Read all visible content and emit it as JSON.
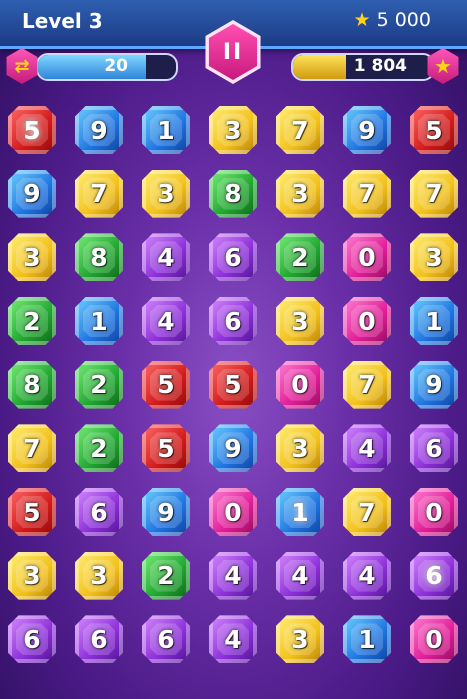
{
  "header": {
    "level_label": "Level 3",
    "score": "5 000",
    "pause_label": "II",
    "moves_value": "20",
    "moves_fill_fraction": 0.78,
    "target_value": "1 804",
    "target_fill_fraction": 0.38,
    "moves_icon": "swap-arrows-icon",
    "target_icon": "star-icon"
  },
  "colors": {
    "red": "#d11919",
    "blue": "#1e73e0",
    "yellow": "#f2c01a",
    "green": "#1fa52f",
    "purple": "#8b2ed8",
    "pink": "#e01c96"
  },
  "board": [
    [
      {
        "n": "5",
        "c": "red",
        "s": true
      },
      {
        "n": "9",
        "c": "blue"
      },
      {
        "n": "1",
        "c": "blue"
      },
      {
        "n": "3",
        "c": "yellow"
      },
      {
        "n": "7",
        "c": "yellow"
      },
      {
        "n": "9",
        "c": "blue"
      },
      {
        "n": "5",
        "c": "red"
      }
    ],
    [
      {
        "n": "9",
        "c": "blue"
      },
      {
        "n": "7",
        "c": "yellow"
      },
      {
        "n": "3",
        "c": "yellow"
      },
      {
        "n": "8",
        "c": "green"
      },
      {
        "n": "3",
        "c": "yellow"
      },
      {
        "n": "7",
        "c": "yellow"
      },
      {
        "n": "7",
        "c": "yellow"
      }
    ],
    [
      {
        "n": "3",
        "c": "yellow"
      },
      {
        "n": "8",
        "c": "green"
      },
      {
        "n": "4",
        "c": "purple"
      },
      {
        "n": "6",
        "c": "purple"
      },
      {
        "n": "2",
        "c": "green"
      },
      {
        "n": "0",
        "c": "pink"
      },
      {
        "n": "3",
        "c": "yellow"
      }
    ],
    [
      {
        "n": "2",
        "c": "green"
      },
      {
        "n": "1",
        "c": "blue"
      },
      {
        "n": "4",
        "c": "purple"
      },
      {
        "n": "6",
        "c": "purple"
      },
      {
        "n": "3",
        "c": "yellow"
      },
      {
        "n": "0",
        "c": "pink"
      },
      {
        "n": "1",
        "c": "blue"
      }
    ],
    [
      {
        "n": "8",
        "c": "green"
      },
      {
        "n": "2",
        "c": "green"
      },
      {
        "n": "5",
        "c": "red"
      },
      {
        "n": "5",
        "c": "red"
      },
      {
        "n": "0",
        "c": "pink"
      },
      {
        "n": "7",
        "c": "yellow"
      },
      {
        "n": "9",
        "c": "blue"
      }
    ],
    [
      {
        "n": "7",
        "c": "yellow"
      },
      {
        "n": "2",
        "c": "green"
      },
      {
        "n": "5",
        "c": "red"
      },
      {
        "n": "9",
        "c": "blue"
      },
      {
        "n": "3",
        "c": "yellow"
      },
      {
        "n": "4",
        "c": "purple"
      },
      {
        "n": "6",
        "c": "purple"
      }
    ],
    [
      {
        "n": "5",
        "c": "red"
      },
      {
        "n": "6",
        "c": "purple"
      },
      {
        "n": "9",
        "c": "blue"
      },
      {
        "n": "0",
        "c": "pink"
      },
      {
        "n": "1",
        "c": "blue",
        "s": true
      },
      {
        "n": "7",
        "c": "yellow"
      },
      {
        "n": "0",
        "c": "pink"
      }
    ],
    [
      {
        "n": "3",
        "c": "yellow"
      },
      {
        "n": "3",
        "c": "yellow"
      },
      {
        "n": "2",
        "c": "green"
      },
      {
        "n": "4",
        "c": "purple"
      },
      {
        "n": "4",
        "c": "purple"
      },
      {
        "n": "4",
        "c": "purple"
      },
      {
        "n": "6",
        "c": "purple",
        "s": true
      }
    ],
    [
      {
        "n": "6",
        "c": "purple"
      },
      {
        "n": "6",
        "c": "purple"
      },
      {
        "n": "6",
        "c": "purple"
      },
      {
        "n": "4",
        "c": "purple"
      },
      {
        "n": "3",
        "c": "yellow"
      },
      {
        "n": "1",
        "c": "blue"
      },
      {
        "n": "0",
        "c": "pink"
      }
    ]
  ]
}
